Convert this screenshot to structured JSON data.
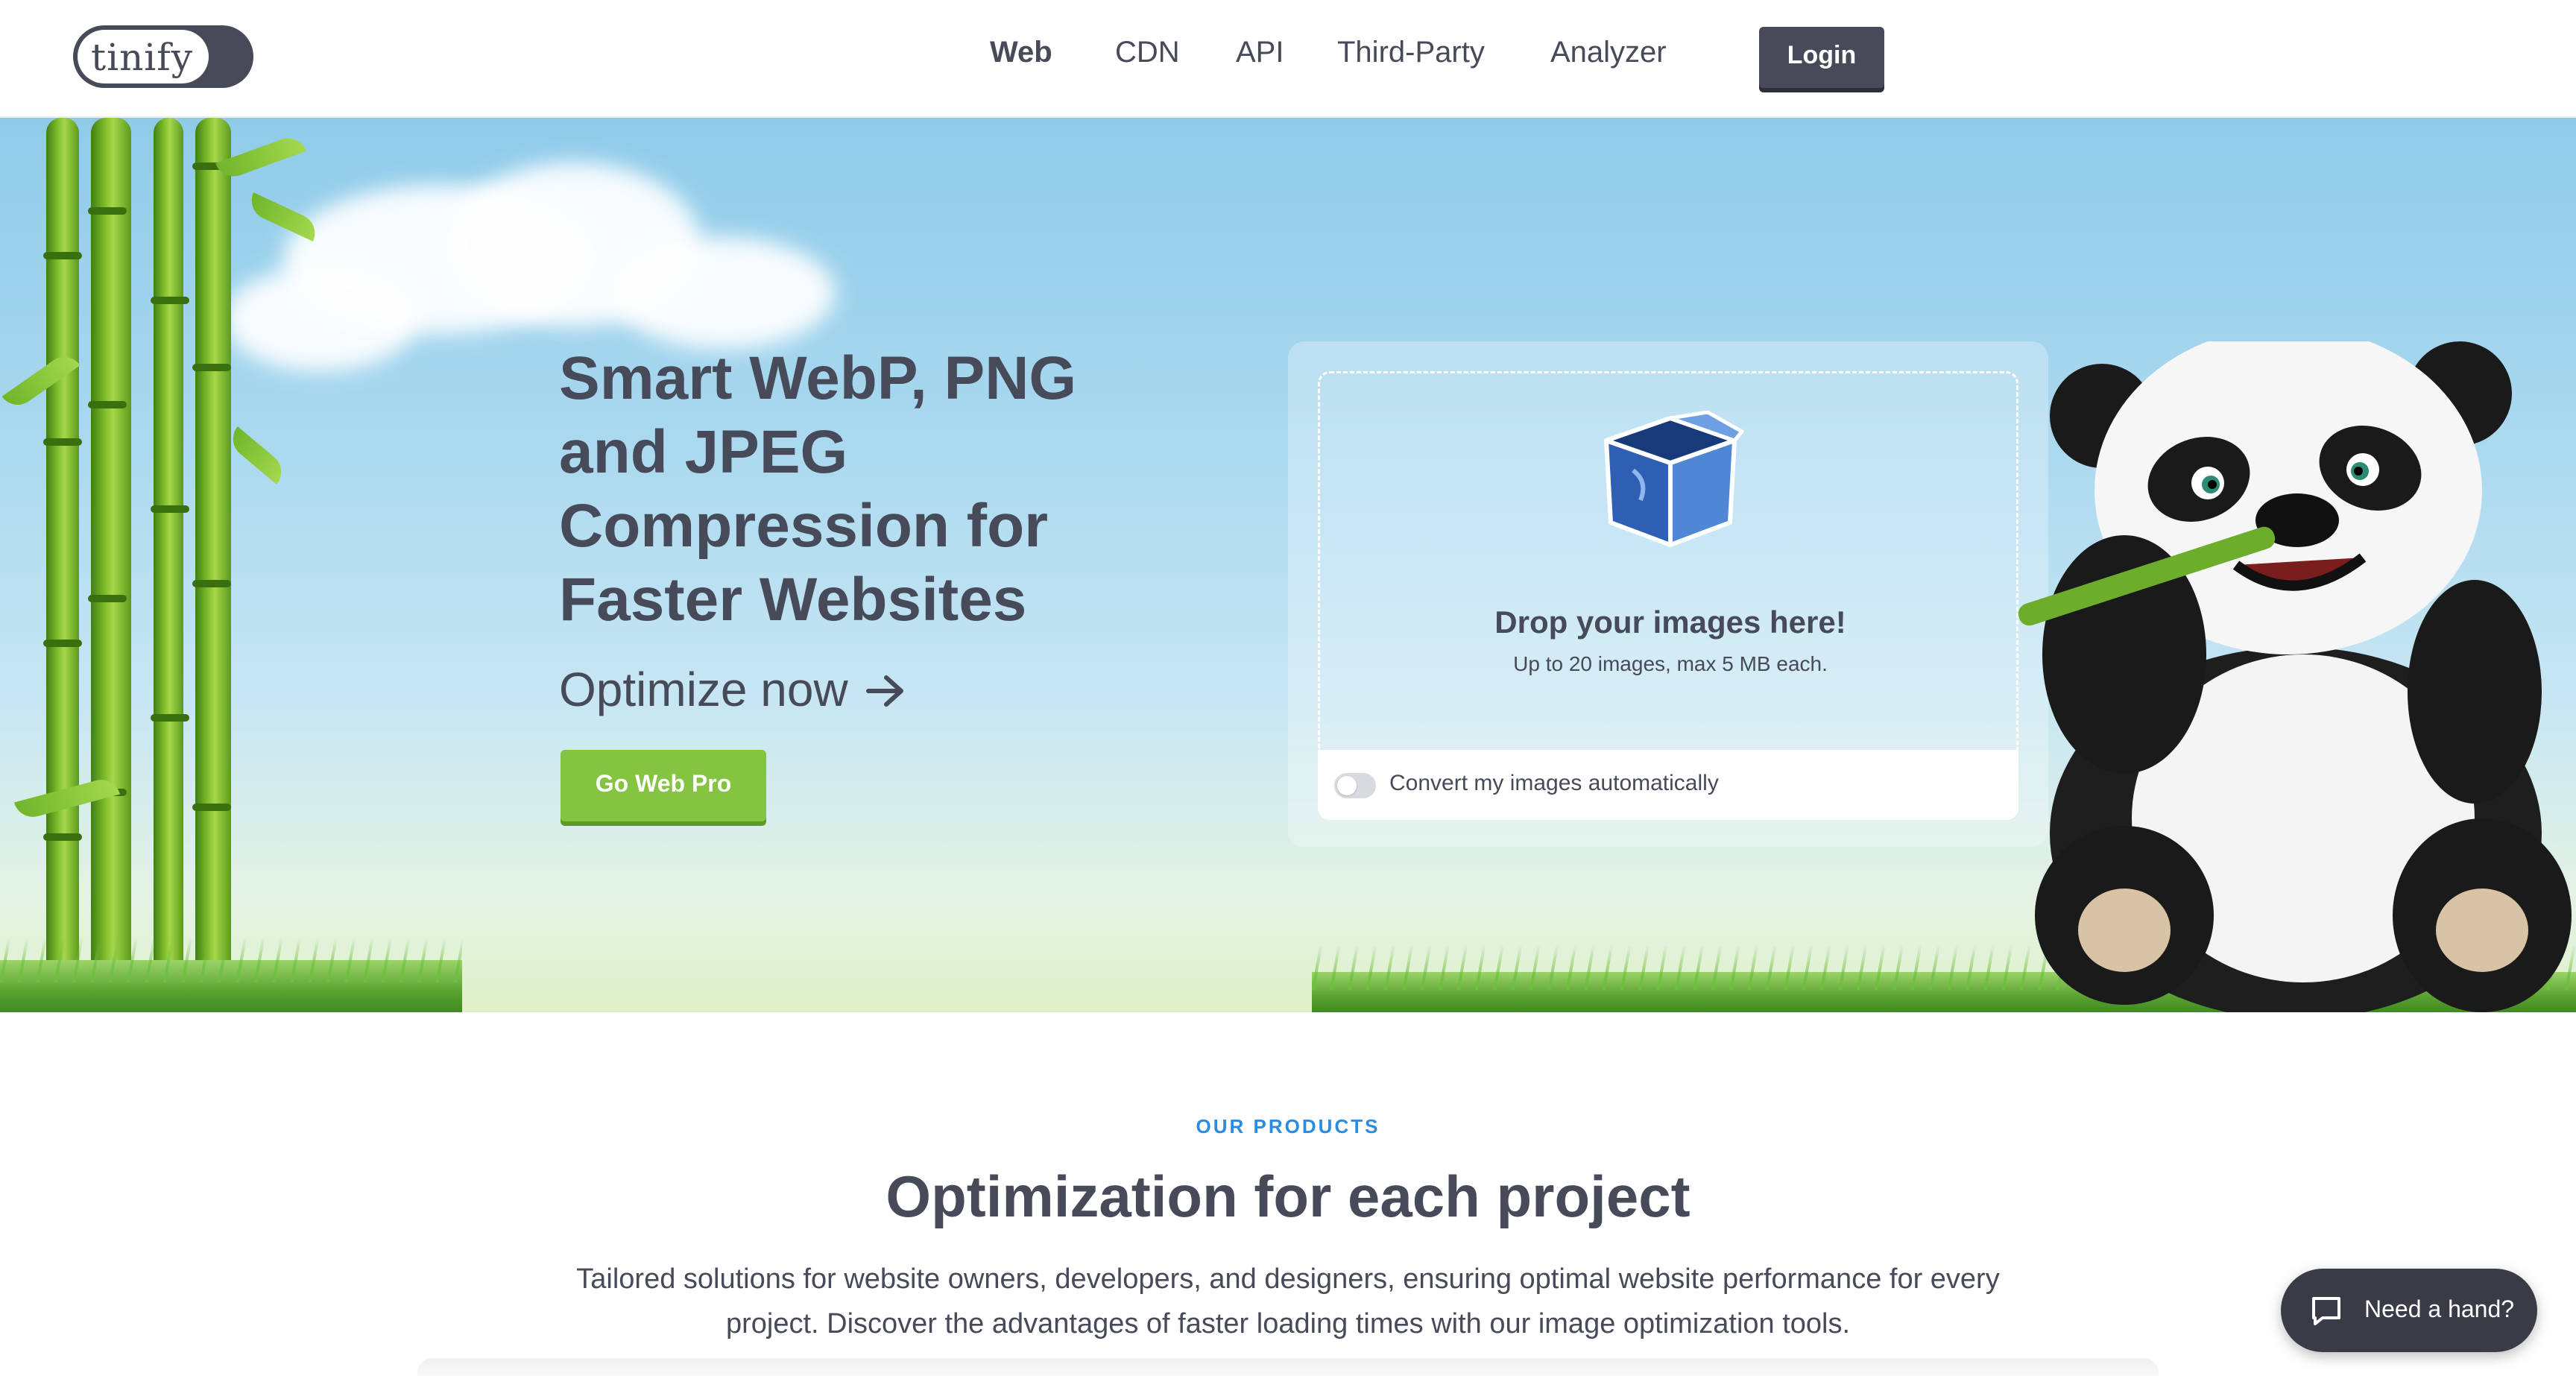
{
  "brand": {
    "logo_text": "tinify"
  },
  "nav": {
    "items": [
      "Web",
      "CDN",
      "API",
      "Third-Party",
      "Analyzer"
    ],
    "active": "Web",
    "login_label": "Login"
  },
  "hero": {
    "title": "Smart WebP, PNG and JPEG Compression for Faster Websites",
    "subtitle": "Optimize now",
    "cta_label": "Go Web Pro",
    "drop": {
      "title": "Drop your images here!",
      "note": "Up to 20 images, max 5 MB each.",
      "convert_label": "Convert my images automatically",
      "convert_enabled": false
    }
  },
  "products": {
    "eyebrow": "OUR PRODUCTS",
    "title": "Optimization for each project",
    "description": "Tailored solutions for website owners, developers, and designers, ensuring optimal website performance for every project. Discover the advantages of faster loading times with our image optimization tools."
  },
  "help": {
    "label": "Need a hand?"
  },
  "colors": {
    "ink": "#474a58",
    "accent_green": "#84c441",
    "accent_blue": "#2a8ce0",
    "sky": "#8fcbe9"
  },
  "icons": [
    "arrow-right-icon",
    "box-icon",
    "chat-icon",
    "panda-mascot",
    "bamboo-illustration"
  ]
}
